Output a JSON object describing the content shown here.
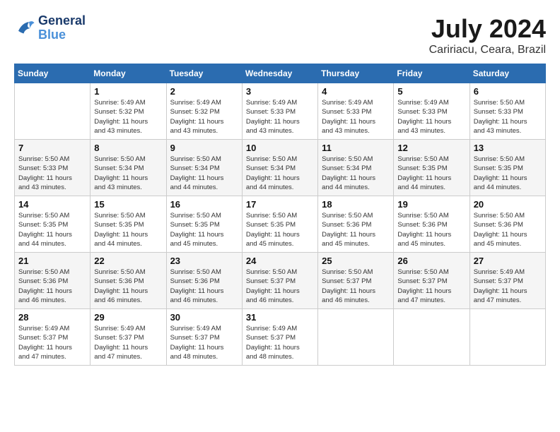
{
  "header": {
    "logo_line1": "General",
    "logo_line2": "Blue",
    "month": "July 2024",
    "location": "Caririacu, Ceara, Brazil"
  },
  "days_of_week": [
    "Sunday",
    "Monday",
    "Tuesday",
    "Wednesday",
    "Thursday",
    "Friday",
    "Saturday"
  ],
  "weeks": [
    [
      {
        "num": "",
        "info": ""
      },
      {
        "num": "1",
        "info": "Sunrise: 5:49 AM\nSunset: 5:32 PM\nDaylight: 11 hours\nand 43 minutes."
      },
      {
        "num": "2",
        "info": "Sunrise: 5:49 AM\nSunset: 5:32 PM\nDaylight: 11 hours\nand 43 minutes."
      },
      {
        "num": "3",
        "info": "Sunrise: 5:49 AM\nSunset: 5:33 PM\nDaylight: 11 hours\nand 43 minutes."
      },
      {
        "num": "4",
        "info": "Sunrise: 5:49 AM\nSunset: 5:33 PM\nDaylight: 11 hours\nand 43 minutes."
      },
      {
        "num": "5",
        "info": "Sunrise: 5:49 AM\nSunset: 5:33 PM\nDaylight: 11 hours\nand 43 minutes."
      },
      {
        "num": "6",
        "info": "Sunrise: 5:50 AM\nSunset: 5:33 PM\nDaylight: 11 hours\nand 43 minutes."
      }
    ],
    [
      {
        "num": "7",
        "info": "Sunrise: 5:50 AM\nSunset: 5:33 PM\nDaylight: 11 hours\nand 43 minutes."
      },
      {
        "num": "8",
        "info": "Sunrise: 5:50 AM\nSunset: 5:34 PM\nDaylight: 11 hours\nand 43 minutes."
      },
      {
        "num": "9",
        "info": "Sunrise: 5:50 AM\nSunset: 5:34 PM\nDaylight: 11 hours\nand 44 minutes."
      },
      {
        "num": "10",
        "info": "Sunrise: 5:50 AM\nSunset: 5:34 PM\nDaylight: 11 hours\nand 44 minutes."
      },
      {
        "num": "11",
        "info": "Sunrise: 5:50 AM\nSunset: 5:34 PM\nDaylight: 11 hours\nand 44 minutes."
      },
      {
        "num": "12",
        "info": "Sunrise: 5:50 AM\nSunset: 5:35 PM\nDaylight: 11 hours\nand 44 minutes."
      },
      {
        "num": "13",
        "info": "Sunrise: 5:50 AM\nSunset: 5:35 PM\nDaylight: 11 hours\nand 44 minutes."
      }
    ],
    [
      {
        "num": "14",
        "info": "Sunrise: 5:50 AM\nSunset: 5:35 PM\nDaylight: 11 hours\nand 44 minutes."
      },
      {
        "num": "15",
        "info": "Sunrise: 5:50 AM\nSunset: 5:35 PM\nDaylight: 11 hours\nand 44 minutes."
      },
      {
        "num": "16",
        "info": "Sunrise: 5:50 AM\nSunset: 5:35 PM\nDaylight: 11 hours\nand 45 minutes."
      },
      {
        "num": "17",
        "info": "Sunrise: 5:50 AM\nSunset: 5:35 PM\nDaylight: 11 hours\nand 45 minutes."
      },
      {
        "num": "18",
        "info": "Sunrise: 5:50 AM\nSunset: 5:36 PM\nDaylight: 11 hours\nand 45 minutes."
      },
      {
        "num": "19",
        "info": "Sunrise: 5:50 AM\nSunset: 5:36 PM\nDaylight: 11 hours\nand 45 minutes."
      },
      {
        "num": "20",
        "info": "Sunrise: 5:50 AM\nSunset: 5:36 PM\nDaylight: 11 hours\nand 45 minutes."
      }
    ],
    [
      {
        "num": "21",
        "info": "Sunrise: 5:50 AM\nSunset: 5:36 PM\nDaylight: 11 hours\nand 46 minutes."
      },
      {
        "num": "22",
        "info": "Sunrise: 5:50 AM\nSunset: 5:36 PM\nDaylight: 11 hours\nand 46 minutes."
      },
      {
        "num": "23",
        "info": "Sunrise: 5:50 AM\nSunset: 5:36 PM\nDaylight: 11 hours\nand 46 minutes."
      },
      {
        "num": "24",
        "info": "Sunrise: 5:50 AM\nSunset: 5:37 PM\nDaylight: 11 hours\nand 46 minutes."
      },
      {
        "num": "25",
        "info": "Sunrise: 5:50 AM\nSunset: 5:37 PM\nDaylight: 11 hours\nand 46 minutes."
      },
      {
        "num": "26",
        "info": "Sunrise: 5:50 AM\nSunset: 5:37 PM\nDaylight: 11 hours\nand 47 minutes."
      },
      {
        "num": "27",
        "info": "Sunrise: 5:49 AM\nSunset: 5:37 PM\nDaylight: 11 hours\nand 47 minutes."
      }
    ],
    [
      {
        "num": "28",
        "info": "Sunrise: 5:49 AM\nSunset: 5:37 PM\nDaylight: 11 hours\nand 47 minutes."
      },
      {
        "num": "29",
        "info": "Sunrise: 5:49 AM\nSunset: 5:37 PM\nDaylight: 11 hours\nand 47 minutes."
      },
      {
        "num": "30",
        "info": "Sunrise: 5:49 AM\nSunset: 5:37 PM\nDaylight: 11 hours\nand 48 minutes."
      },
      {
        "num": "31",
        "info": "Sunrise: 5:49 AM\nSunset: 5:37 PM\nDaylight: 11 hours\nand 48 minutes."
      },
      {
        "num": "",
        "info": ""
      },
      {
        "num": "",
        "info": ""
      },
      {
        "num": "",
        "info": ""
      }
    ]
  ]
}
